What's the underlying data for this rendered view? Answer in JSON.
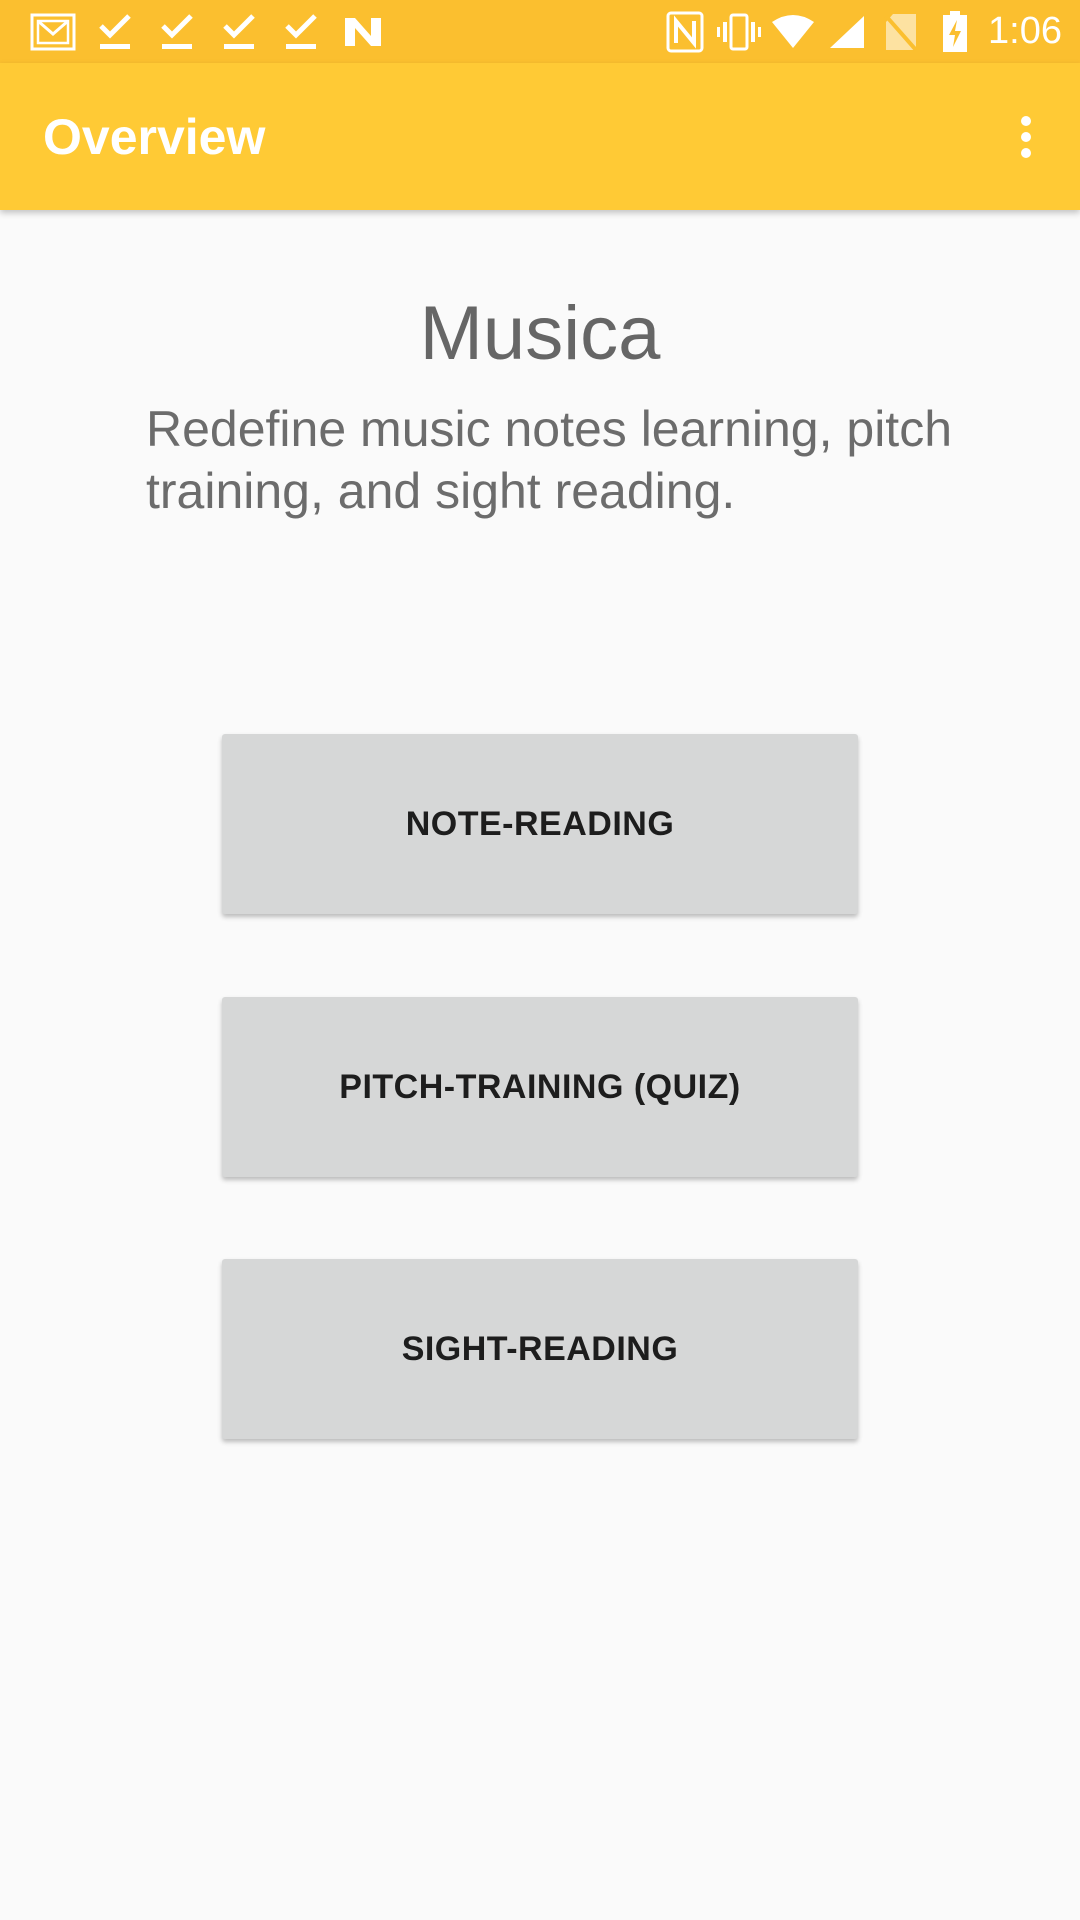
{
  "status_bar": {
    "time": "1:06",
    "left_icons": [
      "gmail-icon",
      "download-done-icon",
      "download-done-icon",
      "download-done-icon",
      "download-done-icon",
      "n-app-icon"
    ],
    "right_icons": [
      "nfc-icon",
      "vibrate-icon",
      "wifi-icon",
      "cell-signal-icon",
      "no-sim-icon",
      "battery-charging-icon"
    ]
  },
  "app_bar": {
    "title": "Overview",
    "overflow_icon": "more-vert-icon",
    "color": "#ffca35"
  },
  "main": {
    "app_name": "Musica",
    "tagline": "Redefine music notes learning, pitch training, and sight reading.",
    "buttons": [
      {
        "label": "NOTE-READING"
      },
      {
        "label": "PITCH-TRAINING (QUIZ)"
      },
      {
        "label": "SIGHT-READING"
      }
    ]
  }
}
